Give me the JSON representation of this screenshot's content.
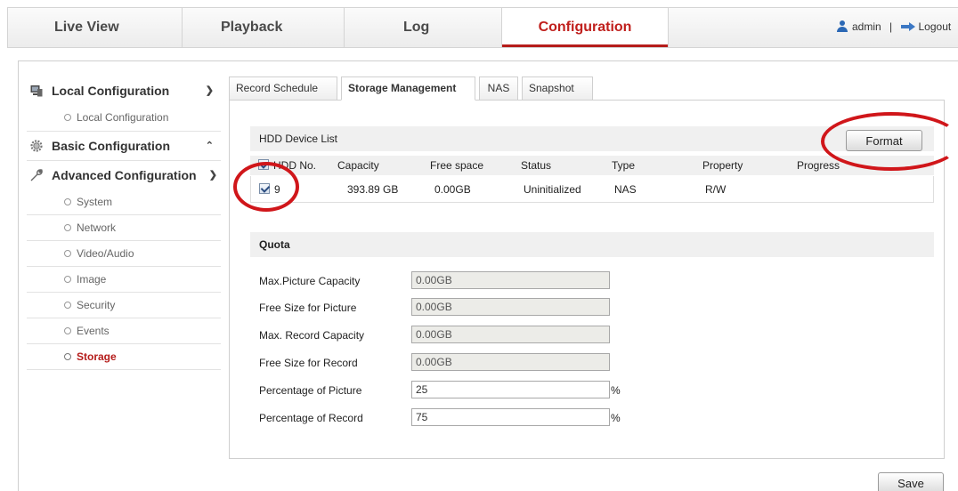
{
  "topnav": {
    "tabs": [
      {
        "label": "Live View"
      },
      {
        "label": "Playback"
      },
      {
        "label": "Log"
      },
      {
        "label": "Configuration",
        "active": true
      }
    ],
    "user": "admin",
    "separator": "|",
    "logout": "Logout"
  },
  "sidebar": {
    "local": {
      "label": "Local Configuration",
      "items": [
        "Local Configuration"
      ]
    },
    "basic": {
      "label": "Basic Configuration"
    },
    "advanced": {
      "label": "Advanced Configuration",
      "items": [
        "System",
        "Network",
        "Video/Audio",
        "Image",
        "Security",
        "Events",
        "Storage"
      ],
      "active_item": "Storage"
    }
  },
  "subtabs": [
    "Record Schedule",
    "Storage Management",
    "NAS",
    "Snapshot"
  ],
  "active_subtab": "Storage Management",
  "hdd": {
    "title": "HDD Device List",
    "format_label": "Format",
    "columns": [
      "HDD No.",
      "Capacity",
      "Free space",
      "Status",
      "Type",
      "Property",
      "Progress"
    ],
    "rows": [
      {
        "no": "9",
        "capacity": "393.89 GB",
        "free": "0.00GB",
        "status": "Uninitialized",
        "type": "NAS",
        "property": "R/W",
        "progress": ""
      }
    ]
  },
  "quota": {
    "title": "Quota",
    "max_picture_label": "Max.Picture Capacity",
    "max_picture": "0.00GB",
    "free_picture_label": "Free Size for Picture",
    "free_picture": "0.00GB",
    "max_record_label": "Max. Record Capacity",
    "max_record": "0.00GB",
    "free_record_label": "Free Size for Record",
    "free_record": "0.00GB",
    "pct_picture_label": "Percentage of Picture",
    "pct_picture": "25",
    "pct_record_label": "Percentage of Record",
    "pct_record": "75",
    "pct_unit": "%"
  },
  "save_label": "Save",
  "colors": {
    "accent": "#b51c1a",
    "annotation": "#d0161a"
  }
}
